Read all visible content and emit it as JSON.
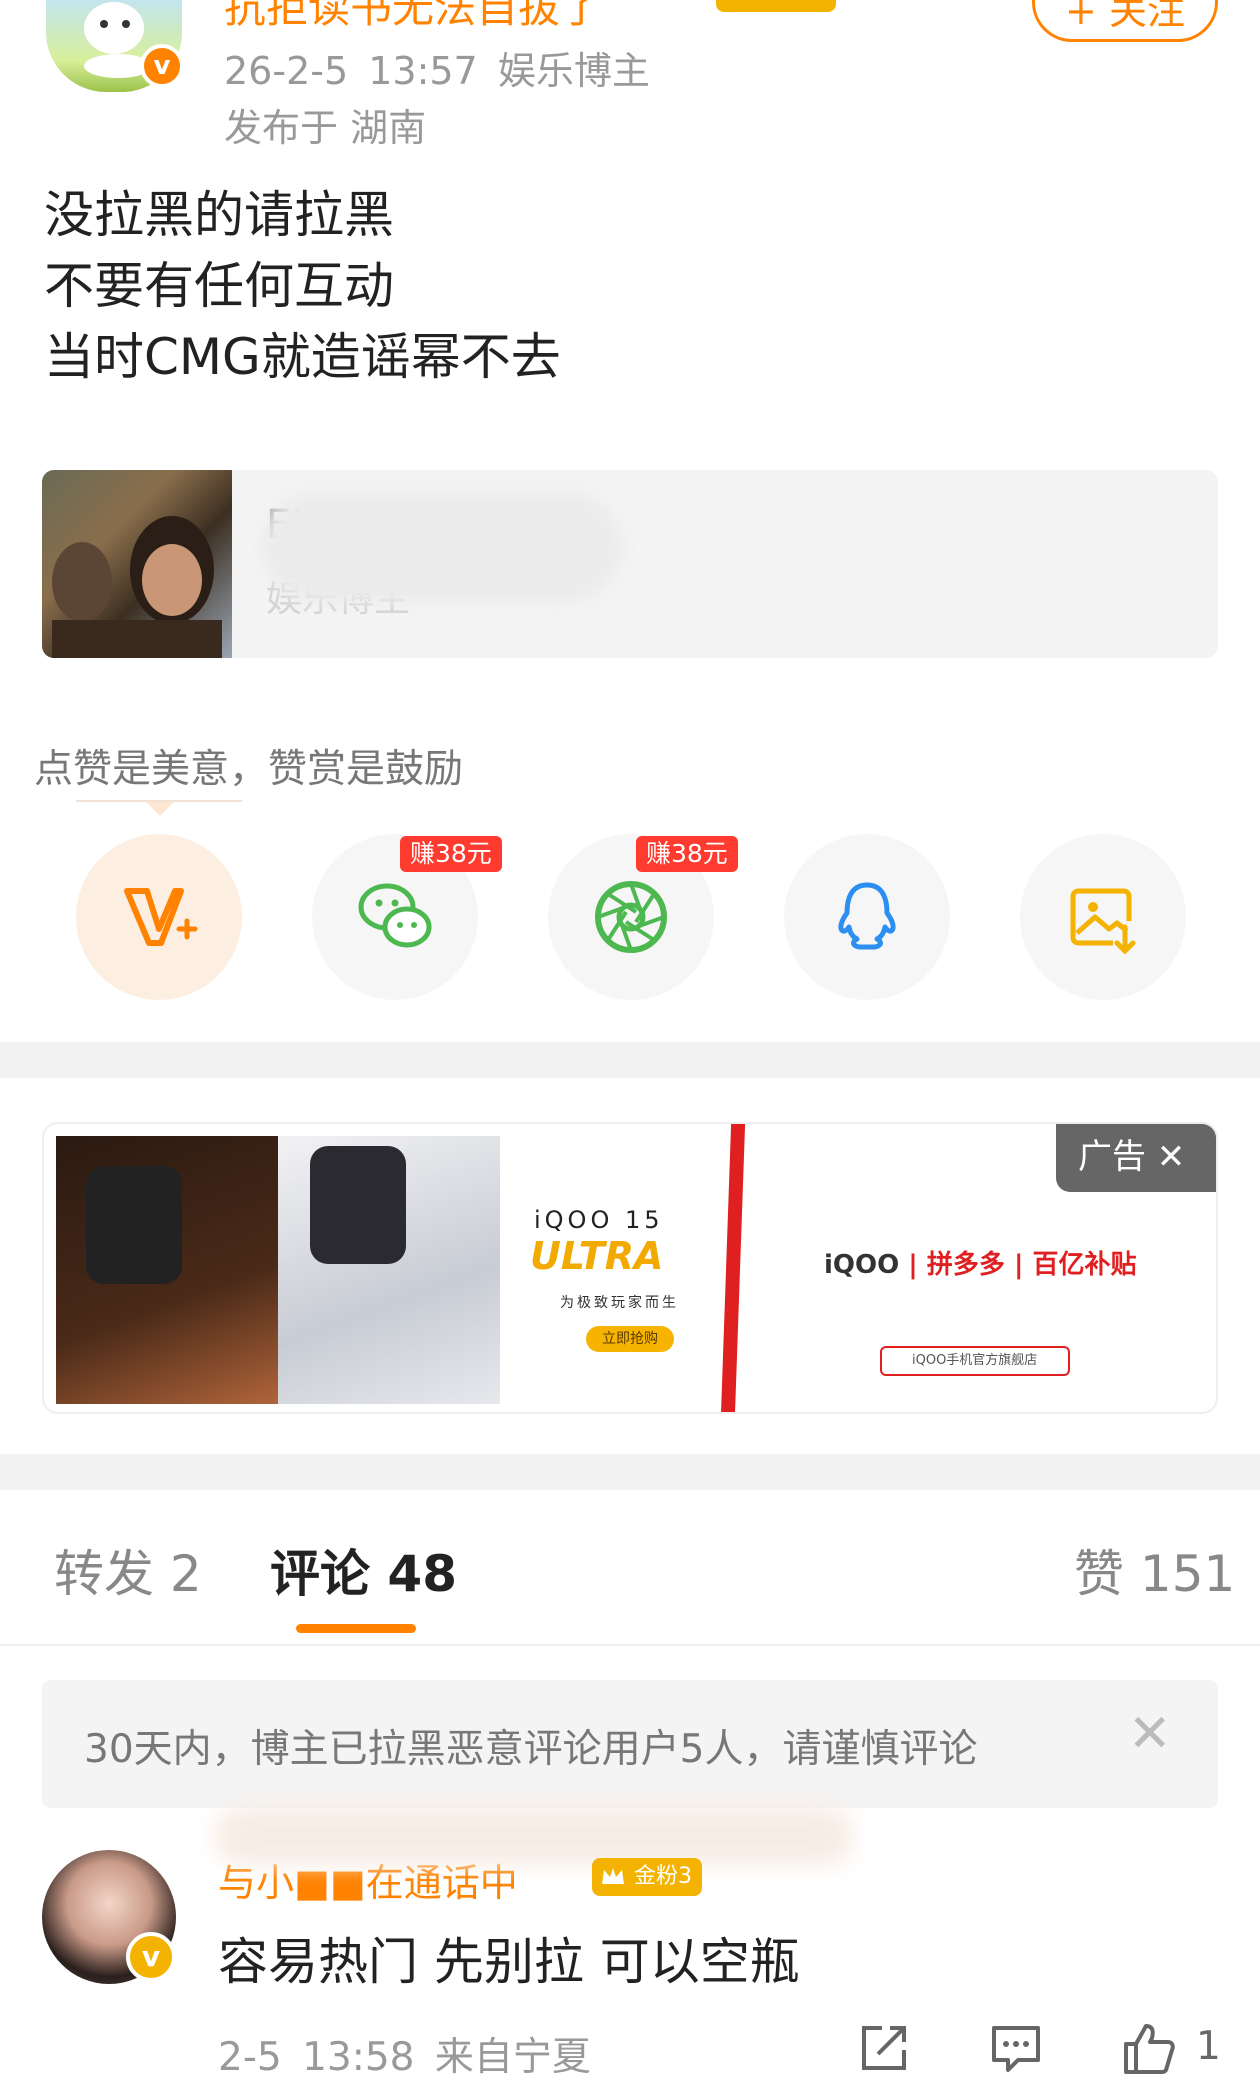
{
  "post": {
    "author": {
      "name": "抗拒读书无法自拔了",
      "time": "26-2-5 13:57",
      "role": "娱乐博主",
      "location": "发布于 湖南",
      "verified_badge": "v"
    },
    "follow_label": "+ 关注",
    "text": "没拉黑的请拉黑\n不要有任何互动\n当时CMG就造谣幂不去",
    "quote_card": {
      "name": "Ell",
      "desc": "娱乐博主"
    }
  },
  "reward": {
    "tip": "点赞是美意，赞赏是鼓励",
    "share_buttons": [
      {
        "name": "reward-v-icon",
        "color": "#ff8200"
      },
      {
        "name": "wechat-icon",
        "badge": "赚38元",
        "color": "#4cb84f"
      },
      {
        "name": "moments-icon",
        "badge": "赚38元",
        "color": "#4cb84f"
      },
      {
        "name": "qq-icon",
        "color": "#2b8ef0"
      },
      {
        "name": "save-image-icon",
        "color": "#f3b300"
      }
    ]
  },
  "ad": {
    "brand": "iQOO 15",
    "headline": "ULTRA",
    "slogan": "为极致玩家而生",
    "buy_label": "立即抢购",
    "partners": [
      "iQOO",
      "拼多多",
      "百亿补贴"
    ],
    "store": "iQOO手机官方旗舰店",
    "tag_label": "广告 ✕"
  },
  "tabs": [
    {
      "label": "转发 2"
    },
    {
      "label": "评论 48",
      "active": true
    },
    {
      "label": "赞 151"
    }
  ],
  "notice": {
    "text": "30天内，博主已拉黑恶意评论用户5人，请谨慎评论",
    "close": "✕"
  },
  "comment": {
    "name": "与小■■在通话中",
    "fan_badge": "金粉3",
    "verified_badge": "v",
    "text": "容易热门 先别拉 可以空瓶",
    "meta": "2-5 13:58  来自宁夏",
    "likes": "1"
  },
  "colors": {
    "accent": "#ff8200",
    "gold": "#f3b300",
    "red": "#ff3b30"
  }
}
